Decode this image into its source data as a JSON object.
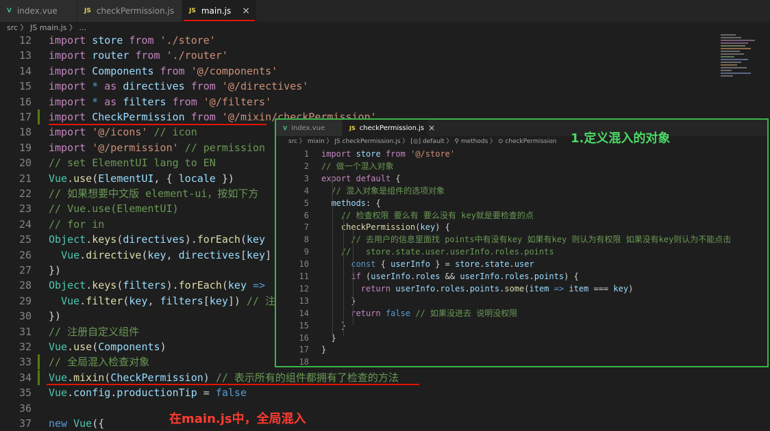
{
  "tabs": [
    {
      "icon": "V",
      "label": "index.vue"
    },
    {
      "icon": "JS",
      "label": "checkPermission.js"
    },
    {
      "icon": "JS",
      "label": "main.js",
      "close": "×"
    }
  ],
  "breadcrumb": "src 〉 JS main.js 〉 ...",
  "editor": {
    "lines": [
      {
        "n": "12",
        "html": "<span class=\"k\">import</span> <span class=\"v\">store</span> <span class=\"k\">from</span> <span class=\"s\">'./store'</span>"
      },
      {
        "n": "13",
        "html": "<span class=\"k\">import</span> <span class=\"v\">router</span> <span class=\"k\">from</span> <span class=\"s\">'./router'</span>"
      },
      {
        "n": "14",
        "html": "<span class=\"k\">import</span> <span class=\"v\">Components</span> <span class=\"k\">from</span> <span class=\"s\">'@/components'</span>"
      },
      {
        "n": "15",
        "html": "<span class=\"k\">import</span> <span class=\"b\">*</span> <span class=\"k\">as</span> <span class=\"v\">directives</span> <span class=\"k\">from</span> <span class=\"s\">'@/directives'</span>"
      },
      {
        "n": "16",
        "html": "<span class=\"k\">import</span> <span class=\"b\">*</span> <span class=\"k\">as</span> <span class=\"v\">filters</span> <span class=\"k\">from</span> <span class=\"s\">'@/filters'</span>"
      },
      {
        "n": "17",
        "html": "<span class=\"k\">import</span> <span class=\"v\">CheckPermission</span> <span class=\"k\">from</span> <span class=\"s\">'@/mixin/checkPermission'</span>"
      },
      {
        "n": "18",
        "html": "<span class=\"k\">import</span> <span class=\"s\">'@/icons'</span> <span class=\"c\">// icon</span>"
      },
      {
        "n": "19",
        "html": "<span class=\"k\">import</span> <span class=\"s\">'@/permission'</span> <span class=\"c\">// permission</span>"
      },
      {
        "n": "20",
        "html": "<span class=\"c\">// set ElementUI lang to EN</span>"
      },
      {
        "n": "21",
        "html": "<span class=\"t\">Vue</span>.<span class=\"f\">use</span>(<span class=\"v\">ElementUI</span>, { <span class=\"v\">locale</span> })"
      },
      {
        "n": "22",
        "html": "<span class=\"c\">// 如果想要中文版 element-ui，按如下方</span>"
      },
      {
        "n": "23",
        "html": "<span class=\"c\">// Vue.use(ElementUI)</span>"
      },
      {
        "n": "24",
        "html": "<span class=\"c\">// for in</span>"
      },
      {
        "n": "25",
        "html": "<span class=\"t\">Object</span>.<span class=\"f\">keys</span>(<span class=\"v\">directives</span>).<span class=\"f\">forEach</span>(<span class=\"v\">key</span>"
      },
      {
        "n": "26",
        "html": "  <span class=\"t\">Vue</span>.<span class=\"f\">directive</span>(<span class=\"v\">key</span>, <span class=\"v\">directives</span>[<span class=\"v\">key</span>]"
      },
      {
        "n": "27",
        "html": "})"
      },
      {
        "n": "28",
        "html": "<span class=\"t\">Object</span>.<span class=\"f\">keys</span>(<span class=\"v\">filters</span>).<span class=\"f\">forEach</span>(<span class=\"v\">key</span> <span class=\"b\">=&gt;</span>"
      },
      {
        "n": "29",
        "html": "  <span class=\"t\">Vue</span>.<span class=\"f\">filter</span>(<span class=\"v\">key</span>, <span class=\"v\">filters</span>[<span class=\"v\">key</span>]) <span class=\"c\">// 注</span>"
      },
      {
        "n": "30",
        "html": "})"
      },
      {
        "n": "31",
        "html": "<span class=\"c\">// 注册自定义组件</span>"
      },
      {
        "n": "32",
        "html": "<span class=\"t\">Vue</span>.<span class=\"f\">use</span>(<span class=\"v\">Components</span>)"
      },
      {
        "n": "33",
        "html": "<span class=\"c\">// 全局混入检查对象</span>"
      },
      {
        "n": "34",
        "html": "<span class=\"t\">Vue</span>.<span class=\"f\">mixin</span>(<span class=\"v\">CheckPermission</span>) <span class=\"c\">// 表示所有的组件都拥有了检查的方法</span>"
      },
      {
        "n": "35",
        "html": "<span class=\"t\">Vue</span>.<span class=\"v\">config</span>.<span class=\"v\">productionTip</span> = <span class=\"b\">false</span>"
      },
      {
        "n": "36",
        "html": ""
      },
      {
        "n": "37",
        "html": "<span class=\"b\">new</span> <span class=\"t\">Vue</span>({"
      }
    ]
  },
  "overlay": {
    "tabs": [
      {
        "icon": "V",
        "label": "index.vue"
      },
      {
        "icon": "JS",
        "label": "checkPermission.js",
        "close": "×"
      }
    ],
    "breadcrumb": "src 〉 mixin 〉 JS checkPermission.js 〉 [◎] default 〉 ⚲ methods 〉 ⊙ checkPermission",
    "lines": [
      {
        "n": "1",
        "html": "<span class=\"k\">import</span> <span class=\"v\">store</span> <span class=\"k\">from</span> <span class=\"s\">'@/store'</span>"
      },
      {
        "n": "2",
        "html": "<span class=\"c\">// 做一个混入对象</span>"
      },
      {
        "n": "3",
        "html": "<span class=\"k\">export</span> <span class=\"k\">default</span> {"
      },
      {
        "n": "4",
        "html": "  <span class=\"c\">// 混入对象是组件的选项对象</span>"
      },
      {
        "n": "5",
        "html": "  <span class=\"v\">methods</span>: {"
      },
      {
        "n": "6",
        "html": "    <span class=\"c\">// 检查权限 要么有 要么没有 key就是要检查的点</span>"
      },
      {
        "n": "7",
        "html": "    <span class=\"f\">checkPermission</span>(<span class=\"v\">key</span>) {"
      },
      {
        "n": "8",
        "html": "      <span class=\"c\">// 去用户的信息里面找 points中有没有key 如果有key 则认为有权限 如果没有key则认为不能点击</span>"
      },
      {
        "n": "9",
        "html": "    <span class=\"c\">//   store.state.user.userInfo.roles.points</span>"
      },
      {
        "n": "10",
        "html": "      <span class=\"b\">const</span> { <span class=\"v\">userInfo</span> } = <span class=\"v\">store</span>.<span class=\"v\">state</span>.<span class=\"v\">user</span>"
      },
      {
        "n": "11",
        "html": "      <span class=\"k\">if</span> (<span class=\"v\">userInfo</span>.<span class=\"v\">roles</span> &amp;&amp; <span class=\"v\">userInfo</span>.<span class=\"v\">roles</span>.<span class=\"v\">points</span>) {"
      },
      {
        "n": "12",
        "html": "        <span class=\"k\">return</span> <span class=\"v\">userInfo</span>.<span class=\"v\">roles</span>.<span class=\"v\">points</span>.<span class=\"f\">some</span>(<span class=\"v\">item</span> <span class=\"b\">=&gt;</span> <span class=\"v\">item</span> === <span class=\"v\">key</span>)"
      },
      {
        "n": "13",
        "html": "      }"
      },
      {
        "n": "14",
        "html": "      <span class=\"k\">return</span> <span class=\"b\">false</span> <span class=\"c\">// 如果没进去 说明没权限</span>"
      },
      {
        "n": "15",
        "html": "    }"
      },
      {
        "n": "16",
        "html": "  }"
      },
      {
        "n": "17",
        "html": "}"
      },
      {
        "n": "18",
        "html": ""
      }
    ]
  },
  "annotations": {
    "green": "1.定义混入的对象",
    "red": "在main.js中，全局混入"
  },
  "colors": {
    "annotation_green": "#3ab54a",
    "annotation_red": "#e51400",
    "background": "#1e1e1e"
  }
}
